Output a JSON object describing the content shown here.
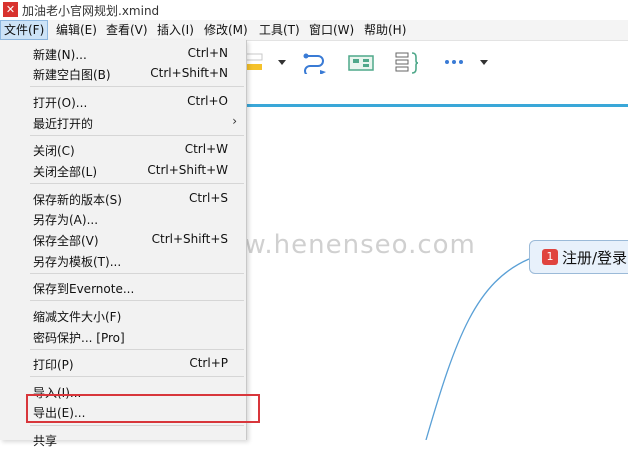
{
  "window": {
    "title": "加油老小官网规划.xmind"
  },
  "menubar": {
    "items": [
      "文件(F)",
      "编辑(E)",
      "查看(V)",
      "插入(I)",
      "修改(M)",
      "工具(T)",
      "窗口(W)",
      "帮助(H)"
    ]
  },
  "file_menu": {
    "items": [
      {
        "label": "新建(N)...",
        "shortcut": "Ctrl+N"
      },
      {
        "label": "新建空白图(B)",
        "shortcut": "Ctrl+Shift+N"
      },
      {
        "label": "打开(O)...",
        "shortcut": "Ctrl+O"
      },
      {
        "label": "最近打开的",
        "shortcut": ""
      },
      {
        "label": "关闭(C)",
        "shortcut": "Ctrl+W"
      },
      {
        "label": "关闭全部(L)",
        "shortcut": "Ctrl+Shift+W"
      },
      {
        "label": "保存新的版本(S)",
        "shortcut": "Ctrl+S"
      },
      {
        "label": "另存为(A)...",
        "shortcut": ""
      },
      {
        "label": "保存全部(V)",
        "shortcut": "Ctrl+Shift+S"
      },
      {
        "label": "另存为模板(T)...",
        "shortcut": ""
      },
      {
        "label": "保存到Evernote...",
        "shortcut": ""
      },
      {
        "label": "缩减文件大小(F)",
        "shortcut": ""
      },
      {
        "label": "密码保护... [Pro]",
        "shortcut": ""
      },
      {
        "label": "打印(P)",
        "shortcut": "Ctrl+P"
      },
      {
        "label": "导入(I)...",
        "shortcut": ""
      },
      {
        "label": "导出(E)...",
        "shortcut": ""
      },
      {
        "label": "共享",
        "shortcut": ""
      }
    ],
    "submenu_arrow": "›"
  },
  "canvas": {
    "node": {
      "badge": "1",
      "label": "注册/登录"
    },
    "watermark": "www.henenseo.com"
  },
  "colors": {
    "accent": "#3aa7d8",
    "highlight": "#d8363b",
    "node_bg": "#e8f1fb"
  }
}
